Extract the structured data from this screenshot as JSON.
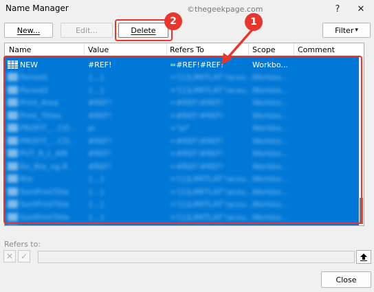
{
  "window": {
    "title": "Name Manager",
    "watermark": "©thegeekpage.com",
    "help_glyph": "?",
    "close_glyph": "✕"
  },
  "toolbar": {
    "new_label": "New...",
    "edit_label": "Edit...",
    "delete_label": "Delete",
    "filter_label": "Filter",
    "filter_arrow": "▾"
  },
  "annotations": {
    "badge_1": "1",
    "badge_2": "2",
    "color": "#e8362c"
  },
  "table": {
    "columns": [
      "Name",
      "Value",
      "Refers To",
      "Scope",
      "Comment"
    ],
    "first_row": {
      "name": "NEW",
      "value": "#REF!",
      "refers_to": "=#REF!#REF!",
      "scope": "Workbo..."
    },
    "blurred_rows": [
      {
        "name": "Period1",
        "value": "{...}",
        "refers_to": "='[1]LIMITLAT'!acou...",
        "scope": "Workbo..."
      },
      {
        "name": "Period2",
        "value": "{...}",
        "refers_to": "='[1]LIMITLAT'!acou...",
        "scope": "Workbo..."
      },
      {
        "name": "Print_Area",
        "value": "#REF!",
        "refers_to": "=#REF!#REF!",
        "scope": "Workbo..."
      },
      {
        "name": "Print_Titles",
        "value": "#REF!",
        "refers_to": "=#REF!#REF!",
        "scope": "Workbo..."
      },
      {
        "name": "PROFIT_...CO...",
        "value": "pl",
        "refers_to": "=\"pl\"",
        "scope": "Workbo..."
      },
      {
        "name": "PROFIT_...CO...",
        "value": "#REF!",
        "refers_to": "=#REF!#REF!",
        "scope": "Workbo..."
      },
      {
        "name": "PUT_R_L_AM",
        "value": "#REF!",
        "refers_to": "=#REF!#REF!",
        "scope": "Workbo..."
      },
      {
        "name": "Rn_Rte_ng.R",
        "value": "#REF!",
        "refers_to": "=#REF!#REF!",
        "scope": "Workbo..."
      },
      {
        "name": "Rte",
        "value": "{...}",
        "refers_to": "='[1]LIMITLAT'!acou...",
        "scope": "Workbo..."
      },
      {
        "name": "SortPrintTitle",
        "value": "{...}",
        "refers_to": "='[1]LIMITLAT'!acou...",
        "scope": "Workbo..."
      },
      {
        "name": "SortPrintTitle",
        "value": "{...}",
        "refers_to": "='[1]LIMITLAT'!acou...",
        "scope": "Workbo..."
      },
      {
        "name": "SortPrintTitle",
        "value": "{...}",
        "refers_to": "='[1]LIMITLAT'!acou...",
        "scope": "Workbo..."
      },
      {
        "name": "T",
        "value": "{...}",
        "refers_to": "='[1]LIMITLAT'!acou...",
        "scope": "Workbo..."
      }
    ],
    "selection_color": "#0078d7"
  },
  "refers_to": {
    "label": "Refers to:",
    "cancel_glyph": "✕",
    "confirm_glyph": "✓",
    "value": ""
  },
  "footer": {
    "close_label": "Close"
  }
}
